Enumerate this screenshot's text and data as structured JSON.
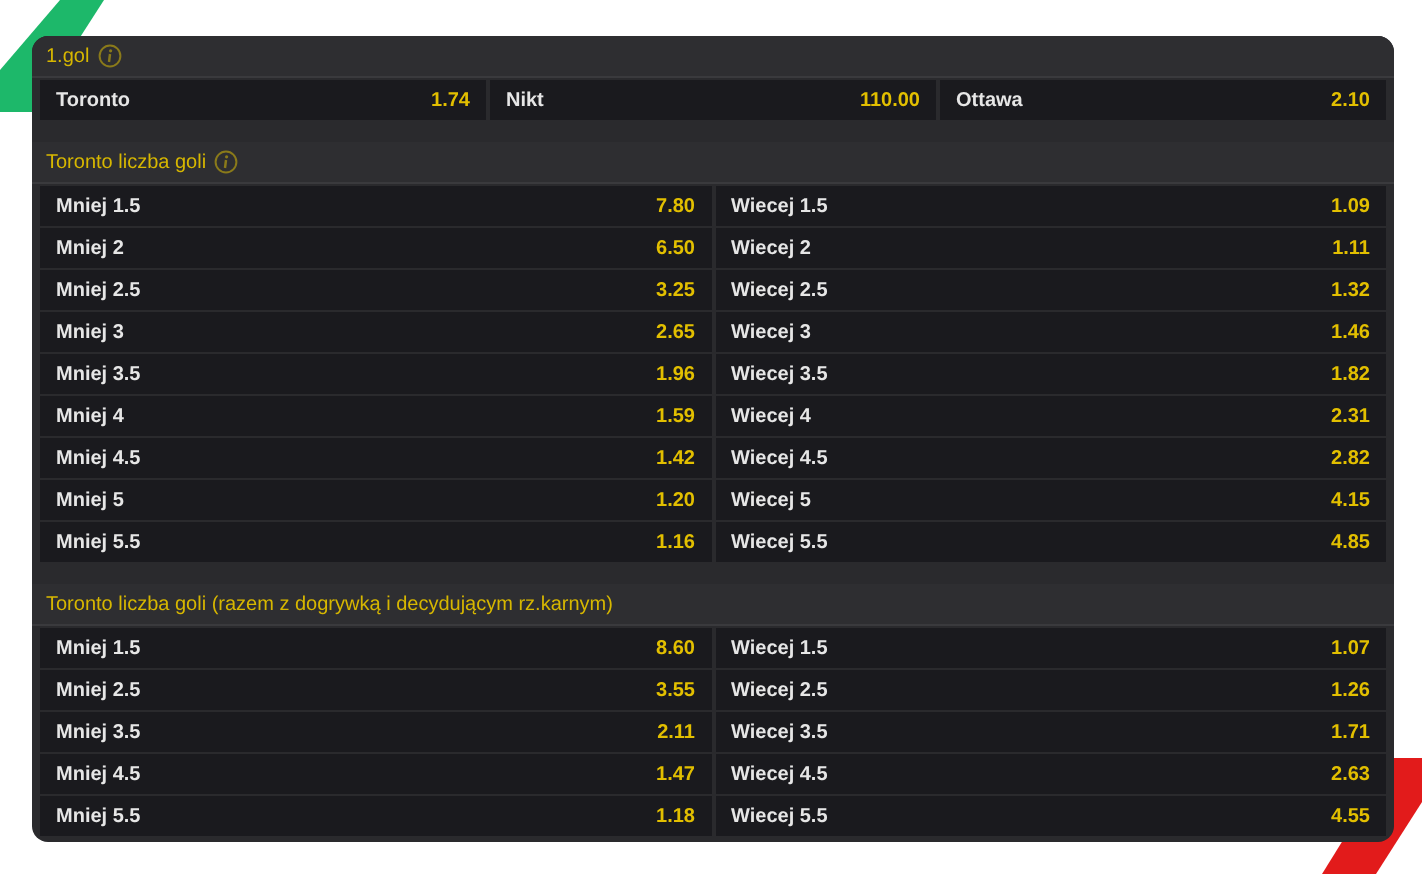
{
  "sections": [
    {
      "title": "1.gol",
      "info": true,
      "kind": "three-way",
      "cells": [
        {
          "label": "Toronto",
          "odds": "1.74"
        },
        {
          "label": "Nikt",
          "odds": "110.00"
        },
        {
          "label": "Ottawa",
          "odds": "2.10"
        }
      ]
    },
    {
      "title": "Toronto liczba goli",
      "info": true,
      "kind": "over-under",
      "cells": [
        {
          "label": "Mniej 1.5",
          "odds": "7.80"
        },
        {
          "label": "Wiecej 1.5",
          "odds": "1.09"
        },
        {
          "label": "Mniej 2",
          "odds": "6.50"
        },
        {
          "label": "Wiecej 2",
          "odds": "1.11"
        },
        {
          "label": "Mniej 2.5",
          "odds": "3.25"
        },
        {
          "label": "Wiecej 2.5",
          "odds": "1.32"
        },
        {
          "label": "Mniej 3",
          "odds": "2.65"
        },
        {
          "label": "Wiecej 3",
          "odds": "1.46"
        },
        {
          "label": "Mniej 3.5",
          "odds": "1.96"
        },
        {
          "label": "Wiecej 3.5",
          "odds": "1.82"
        },
        {
          "label": "Mniej 4",
          "odds": "1.59"
        },
        {
          "label": "Wiecej 4",
          "odds": "2.31"
        },
        {
          "label": "Mniej 4.5",
          "odds": "1.42"
        },
        {
          "label": "Wiecej 4.5",
          "odds": "2.82"
        },
        {
          "label": "Mniej 5",
          "odds": "1.20"
        },
        {
          "label": "Wiecej 5",
          "odds": "4.15"
        },
        {
          "label": "Mniej 5.5",
          "odds": "1.16"
        },
        {
          "label": "Wiecej 5.5",
          "odds": "4.85"
        }
      ]
    },
    {
      "title": "Toronto liczba goli (razem z dogrywką i decydującym rz.karnym)",
      "info": false,
      "kind": "over-under",
      "cells": [
        {
          "label": "Mniej 1.5",
          "odds": "8.60"
        },
        {
          "label": "Wiecej 1.5",
          "odds": "1.07"
        },
        {
          "label": "Mniej 2.5",
          "odds": "3.55"
        },
        {
          "label": "Wiecej 2.5",
          "odds": "1.26"
        },
        {
          "label": "Mniej 3.5",
          "odds": "2.11"
        },
        {
          "label": "Wiecej 3.5",
          "odds": "1.71"
        },
        {
          "label": "Mniej 4.5",
          "odds": "1.47"
        },
        {
          "label": "Wiecej 4.5",
          "odds": "2.63"
        },
        {
          "label": "Mniej 5.5",
          "odds": "1.18"
        },
        {
          "label": "Wiecej 5.5",
          "odds": "4.55"
        }
      ]
    }
  ]
}
